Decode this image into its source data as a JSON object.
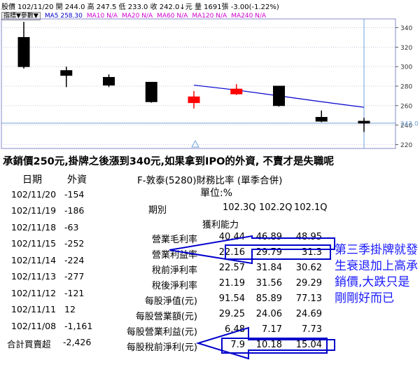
{
  "header": {
    "line1": "股價  102/11/20 開 244.0 高 247.5 低 233.0 收 242.0↓元 量 1691張 -3.00(-1.22%)",
    "line2_label": "指標▼參數▼",
    "ma5": "MA5 258.30",
    "ma10": "MA10 N/A",
    "ma20": "MA20 N/A",
    "ma60": "MA60 N/A",
    "ma120": "MA120 N/A",
    "ma240": "MA240 N/A"
  },
  "chart_data": {
    "type": "candlestick",
    "yticks": [
      "340",
      "320",
      "300",
      "280",
      "260",
      "240",
      "220"
    ],
    "ylim": [
      216,
      349
    ],
    "last_price_label": "242.0",
    "candles": [
      {
        "date": "102/11/08",
        "open": 330,
        "high": 346,
        "low": 298,
        "close": 300,
        "color": "black"
      },
      {
        "date": "102/11/11",
        "open": 296,
        "high": 300,
        "low": 279,
        "close": 291,
        "color": "black"
      },
      {
        "date": "102/11/12",
        "open": 289,
        "high": 292,
        "low": 279,
        "close": 281,
        "color": "black"
      },
      {
        "date": "102/11/13",
        "open": 284,
        "high": 284,
        "low": 263,
        "close": 264,
        "color": "black"
      },
      {
        "date": "102/11/14",
        "open": 263,
        "high": 275,
        "low": 257,
        "close": 269,
        "color": "red"
      },
      {
        "date": "102/11/15",
        "open": 272,
        "high": 282,
        "low": 271,
        "close": 277,
        "color": "red"
      },
      {
        "date": "102/11/18",
        "open": 280,
        "high": 280,
        "low": 259,
        "close": 260,
        "color": "black"
      },
      {
        "date": "102/11/19",
        "open": 248,
        "high": 255,
        "low": 243,
        "close": 244,
        "color": "black"
      },
      {
        "date": "102/11/20",
        "open": 244,
        "high": 247.5,
        "low": 233,
        "close": 242,
        "color": "black"
      }
    ],
    "ma5": [
      null,
      null,
      null,
      null,
      281,
      276,
      270,
      264,
      258.3
    ]
  },
  "title": "承銷價250元,掛牌之後漲到340元,如果拿到IPO的外資, 不賣才是失職呢",
  "flows": {
    "headers": [
      "日期",
      "外資"
    ],
    "rows": [
      [
        "102/11/20",
        "-154"
      ],
      [
        "102/11/19",
        "-186"
      ],
      [
        "102/11/18",
        "-63"
      ],
      [
        "102/11/15",
        "-252"
      ],
      [
        "102/11/14",
        "-224"
      ],
      [
        "102/11/13",
        "-277"
      ],
      [
        "102/11/12",
        "-121"
      ],
      [
        "102/11/11",
        "12"
      ],
      [
        "102/11/08",
        "-1,161"
      ]
    ],
    "total_label": "合計買賣超",
    "total_value": "-2,426"
  },
  "fin": {
    "title": "F-敦泰(5280)財務比率 (單季合併)",
    "unit": "單位:%",
    "period_label": "期別",
    "periods": [
      "102.3Q",
      "102.2Q",
      "102.1Q"
    ],
    "section": "獲利能力",
    "rows": [
      {
        "label": "營業毛利率",
        "values": [
          "40.44",
          "46.89",
          "48.95"
        ]
      },
      {
        "label": "營業利益率",
        "values": [
          "22.16",
          "29.79",
          "31.3"
        ]
      },
      {
        "label": "稅前淨利率",
        "values": [
          "22.57",
          "31.84",
          "30.62"
        ]
      },
      {
        "label": "稅後淨利率",
        "values": [
          "21.19",
          "31.56",
          "29.29"
        ]
      },
      {
        "label": "每股淨值(元)",
        "values": [
          "91.54",
          "85.89",
          "77.13"
        ]
      },
      {
        "label": "每股營業額(元)",
        "values": [
          "29.25",
          "24.06",
          "24.69"
        ]
      },
      {
        "label": "每股營業利益(元)",
        "values": [
          "6.48",
          "7.17",
          "7.73"
        ]
      },
      {
        "label": "每股稅前淨利(元)",
        "values": [
          "7.9",
          "10.18",
          "15.04"
        ]
      }
    ]
  },
  "note": "第三季掛牌就發生衰退加上高承銷價,大跌只是剛剛好而已",
  "colors": {
    "up": "#ff0000",
    "down": "#000000",
    "ma5": "#0000cc",
    "annotation": "#0000cc",
    "note": "#1a1aff"
  }
}
